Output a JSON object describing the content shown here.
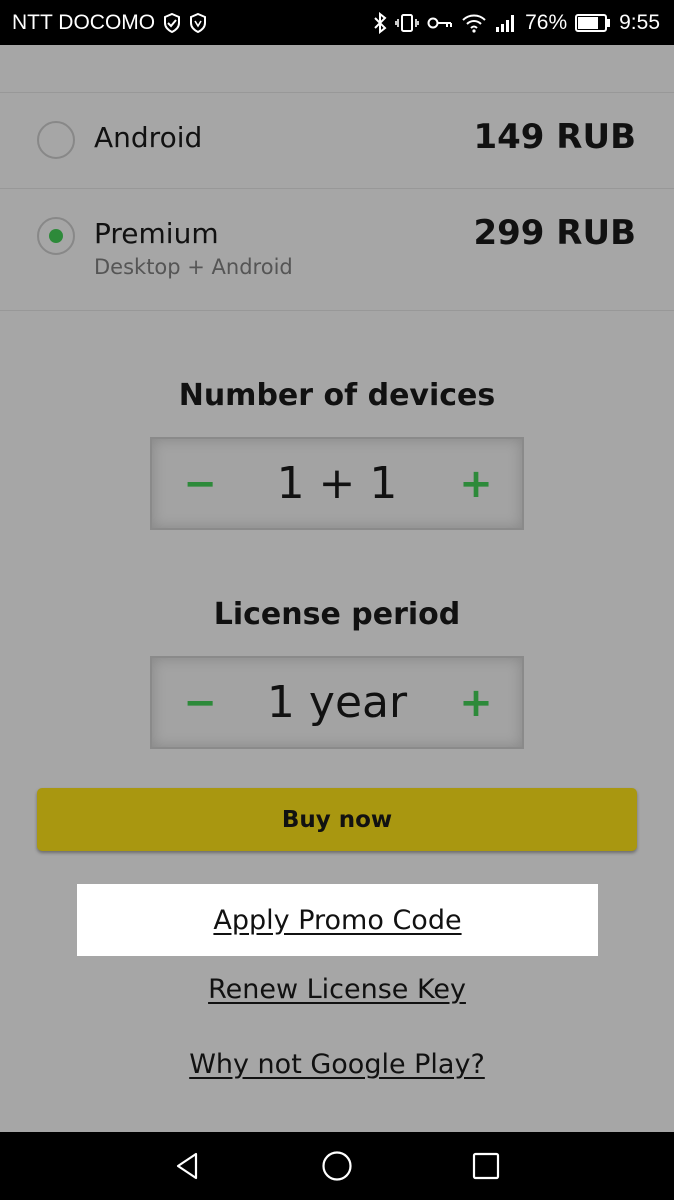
{
  "status_bar": {
    "carrier": "NTT DOCOMO",
    "battery": "76%",
    "time": "9:55",
    "icons_left": [
      "shield-icon",
      "vpn-shield-icon"
    ],
    "icons_right": [
      "bluetooth-icon",
      "vibrate-icon",
      "key-icon",
      "wifi-icon",
      "signal-icon",
      "battery-icon"
    ]
  },
  "plans": [
    {
      "name": "Android",
      "subtitle": "",
      "price": "149 RUB",
      "selected": false
    },
    {
      "name": "Premium",
      "subtitle": "Desktop + Android",
      "price": "299 RUB",
      "selected": true
    }
  ],
  "devices": {
    "title": "Number of devices",
    "value": "1 + 1",
    "minus": "−",
    "plus": "+"
  },
  "period": {
    "title": "License period",
    "value": "1 year",
    "minus": "−",
    "plus": "+"
  },
  "buy_button": "Buy now",
  "links": {
    "promo": "Apply Promo Code",
    "renew": "Renew License Key",
    "why": "Why not Google Play?"
  },
  "nav_bar": [
    "back-icon",
    "home-icon",
    "recents-icon"
  ],
  "colors": {
    "accent_green": "#2d8a3a",
    "buy_button": "#a99710",
    "background": "#a6a6a6"
  }
}
